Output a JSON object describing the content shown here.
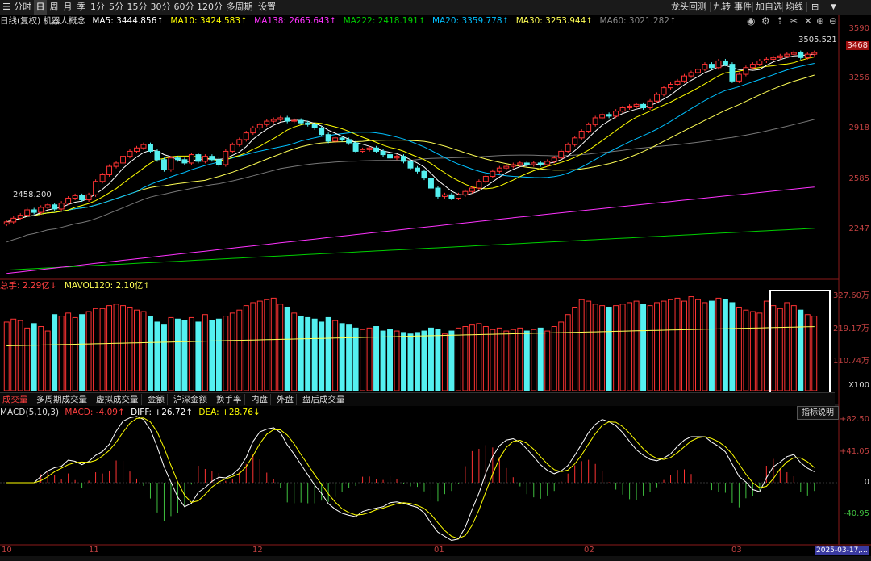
{
  "toolbar": {
    "items": [
      "分时",
      "日",
      "周",
      "月",
      "季",
      "1分",
      "5分",
      "15分",
      "30分",
      "60分",
      "120分",
      "多周期",
      "设置"
    ],
    "active": "日",
    "right_items": [
      "龙头回测",
      "九转",
      "事件",
      "加自选",
      "均线"
    ]
  },
  "indicator_line": {
    "label": "日线(复权) 机器人概念",
    "ma5": "MA5: 3444.856↑",
    "ma10": "MA10: 3424.583↑",
    "ma138": "MA138: 2665.643↑",
    "ma222": "MA222: 2418.191↑",
    "ma20": "MA20: 3359.778↑",
    "ma30": "MA30: 3253.944↑",
    "ma60": "MA60: 3021.282↑"
  },
  "price_axis": [
    "3590",
    "3468",
    "3256",
    "2918",
    "2585",
    "2247"
  ],
  "annotations": {
    "high": "3505.521",
    "low": "2458.200"
  },
  "volume_panel": {
    "title_total": "总手: 2.29亿↓",
    "title_ma": "MAVOL120: 2.10亿↑",
    "axis": [
      "327.60万",
      "219.17万",
      "110.74万",
      "X100"
    ]
  },
  "tabs": [
    "成交量",
    "多周期成交量",
    "虚拟成交量",
    "金额",
    "沪深金额",
    "换手率",
    "内盘",
    "外盘",
    "盘后成交量"
  ],
  "active_tab": "成交量",
  "macd_panel": {
    "label": "MACD(5,10,3)",
    "macd": "MACD: -4.09↑",
    "diff": "DIFF: +26.72↑",
    "dea": "DEA: +28.76↓",
    "help": "指标说明",
    "axis": [
      "+82.50",
      "+41.05",
      "0",
      "-40.95"
    ]
  },
  "date_axis": {
    "labels": [
      "10",
      "11",
      "12",
      "01",
      "02",
      "03"
    ],
    "current": "2025-03-17,..."
  },
  "colors": {
    "up": "#ff3333",
    "down": "#54f0f0",
    "ma5": "#ffffff",
    "ma10": "#ffff00",
    "ma20": "#00c0ff",
    "ma30": "#ffff55",
    "ma60": "#777777",
    "ma138": "#ff33ff",
    "ma222": "#00d000"
  },
  "chart_data": {
    "type": "candlestick",
    "title": "机器人概念",
    "y_range": [
      2120,
      3620
    ],
    "closes": [
      2458,
      2480,
      2498,
      2530,
      2515,
      2545,
      2560,
      2535,
      2570,
      2600,
      2615,
      2590,
      2620,
      2700,
      2740,
      2790,
      2810,
      2850,
      2880,
      2900,
      2920,
      2880,
      2830,
      2770,
      2840,
      2830,
      2810,
      2860,
      2820,
      2850,
      2830,
      2800,
      2880,
      2920,
      2950,
      2990,
      3020,
      3040,
      3060,
      3070,
      3080,
      3060,
      3065,
      3050,
      3040,
      3020,
      2980,
      2940,
      2960,
      2950,
      2930,
      2880,
      2890,
      2900,
      2880,
      2860,
      2840,
      2850,
      2820,
      2780,
      2760,
      2720,
      2660,
      2610,
      2620,
      2600,
      2620,
      2640,
      2660,
      2700,
      2730,
      2760,
      2780,
      2790,
      2800,
      2810,
      2800,
      2810,
      2800,
      2820,
      2840,
      2880,
      2920,
      2960,
      3000,
      3040,
      3080,
      3100,
      3090,
      3120,
      3140,
      3150,
      3160,
      3140,
      3180,
      3220,
      3260,
      3280,
      3300,
      3330,
      3350,
      3370,
      3400,
      3380,
      3420,
      3400,
      3300,
      3340,
      3380,
      3400,
      3420,
      3430,
      3440,
      3450,
      3460,
      3470,
      3440,
      3460,
      3470
    ],
    "opens": [
      2445,
      2458,
      2480,
      2498,
      2530,
      2515,
      2545,
      2560,
      2535,
      2570,
      2600,
      2615,
      2590,
      2620,
      2700,
      2740,
      2790,
      2810,
      2850,
      2880,
      2900,
      2920,
      2880,
      2830,
      2770,
      2840,
      2830,
      2810,
      2860,
      2820,
      2850,
      2830,
      2800,
      2880,
      2920,
      2950,
      2990,
      3020,
      3040,
      3060,
      3070,
      3080,
      3060,
      3065,
      3050,
      3040,
      3020,
      2980,
      2940,
      2960,
      2950,
      2930,
      2880,
      2890,
      2900,
      2880,
      2860,
      2840,
      2850,
      2820,
      2780,
      2760,
      2720,
      2660,
      2610,
      2620,
      2600,
      2620,
      2640,
      2660,
      2700,
      2730,
      2760,
      2780,
      2790,
      2800,
      2810,
      2800,
      2810,
      2800,
      2820,
      2840,
      2880,
      2920,
      2960,
      3000,
      3040,
      3080,
      3100,
      3090,
      3120,
      3140,
      3150,
      3160,
      3140,
      3180,
      3220,
      3260,
      3280,
      3300,
      3330,
      3350,
      3370,
      3400,
      3380,
      3420,
      3400,
      3300,
      3340,
      3380,
      3400,
      3420,
      3430,
      3440,
      3450,
      3460,
      3470,
      3440,
      3460
    ],
    "volume": [
      230,
      240,
      235,
      210,
      225,
      215,
      200,
      255,
      250,
      260,
      245,
      255,
      265,
      275,
      275,
      285,
      290,
      285,
      280,
      270,
      265,
      250,
      230,
      220,
      245,
      240,
      235,
      245,
      230,
      255,
      235,
      240,
      250,
      260,
      270,
      285,
      295,
      300,
      305,
      310,
      290,
      280,
      260,
      250,
      245,
      240,
      230,
      245,
      235,
      225,
      220,
      210,
      205,
      210,
      215,
      200,
      205,
      200,
      195,
      190,
      195,
      200,
      210,
      205,
      190,
      200,
      210,
      215,
      220,
      225,
      215,
      205,
      210,
      200,
      205,
      210,
      200,
      205,
      210,
      200,
      215,
      230,
      255,
      280,
      305,
      300,
      290,
      285,
      280,
      285,
      290,
      295,
      300,
      290,
      285,
      295,
      300,
      305,
      310,
      300,
      315,
      305,
      295,
      300,
      310,
      305,
      295,
      280,
      270,
      265,
      260,
      300,
      285,
      275,
      295,
      285,
      270,
      255,
      250
    ],
    "macd_diff_range": [
      -82.5,
      82.5
    ]
  }
}
